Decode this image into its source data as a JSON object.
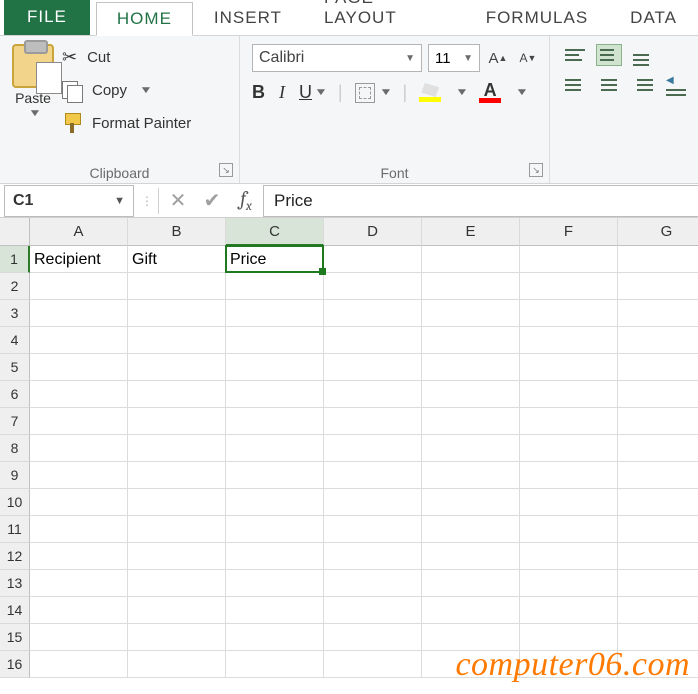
{
  "tabs": {
    "file": "FILE",
    "home": "HOME",
    "insert": "INSERT",
    "pagelayout": "PAGE LAYOUT",
    "formulas": "FORMULAS",
    "data": "DATA"
  },
  "clipboard": {
    "paste": "Paste",
    "cut": "Cut",
    "copy": "Copy",
    "format_painter": "Format Painter",
    "group_label": "Clipboard"
  },
  "font": {
    "name": "Calibri",
    "size": "11",
    "group_label": "Font"
  },
  "namebox": "C1",
  "formula_value": "Price",
  "columns": [
    "A",
    "B",
    "C",
    "D",
    "E",
    "F",
    "G"
  ],
  "rows": [
    "1",
    "2",
    "3",
    "4",
    "5",
    "6",
    "7",
    "8",
    "9",
    "10",
    "11",
    "12",
    "13",
    "14",
    "15",
    "16"
  ],
  "cells": {
    "A1": "Recipient",
    "B1": "Gift",
    "C1": "Price"
  },
  "selection": {
    "col": "C",
    "row": "1"
  },
  "watermark": "computer06.com"
}
